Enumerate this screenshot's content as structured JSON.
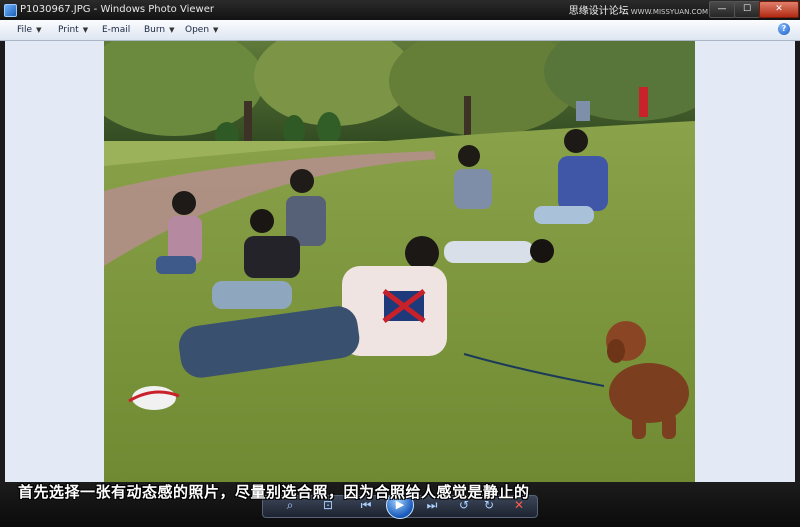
{
  "window": {
    "title": "P1030967.JPG - Windows Photo Viewer",
    "watermark": "思缘设计论坛",
    "watermark_url": "WWW.MISSYUAN.COM",
    "buttons": {
      "minimize": "—",
      "maximize": "☐",
      "close": "✕"
    }
  },
  "menu": {
    "items": [
      {
        "label": "File",
        "has_dropdown": true
      },
      {
        "label": "Print",
        "has_dropdown": true
      },
      {
        "label": "E-mail",
        "has_dropdown": false
      },
      {
        "label": "Burn",
        "has_dropdown": true
      },
      {
        "label": "Open",
        "has_dropdown": true
      }
    ],
    "help_glyph": "?"
  },
  "photo": {
    "icon": "photo-of-friends-on-lawn-with-dog"
  },
  "controls": {
    "zoom": "⌕",
    "actual_size": "⊡",
    "previous": "⏮",
    "slideshow": "▶",
    "next": "⏭",
    "rotate_ccw": "↺",
    "rotate_cw": "↻",
    "delete": "✕"
  },
  "caption": "首先选择一张有动态感的照片，尽量别选合照，因为合照给人感觉是静止的",
  "colors": {
    "accent": "#1657b8",
    "viewer_bg": "#e3eaf5",
    "delete": "#ff5a4a"
  }
}
